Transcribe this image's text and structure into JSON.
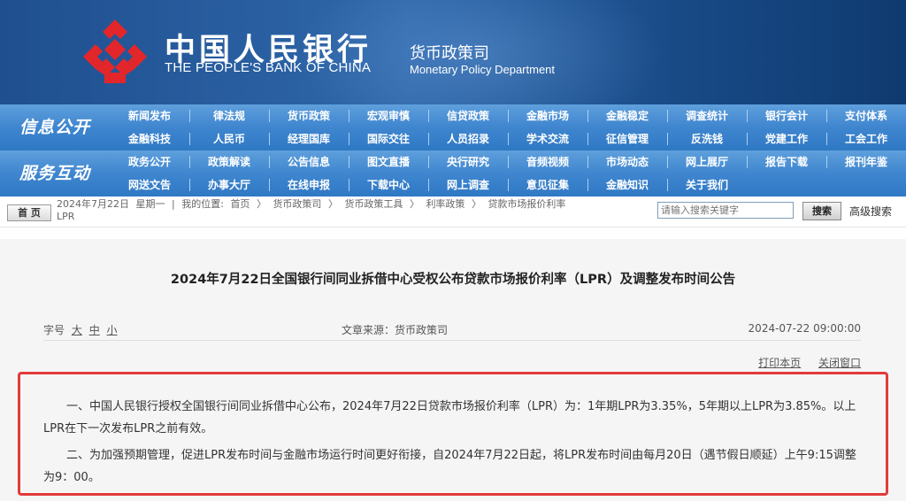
{
  "header": {
    "bank_cn": "中国人民银行",
    "bank_en": "THE PEOPLE'S BANK OF CHINA",
    "dept_cn": "货币政策司",
    "dept_en": "Monetary Policy Department",
    "logo_icon": "pboc-emblem-icon",
    "colors": {
      "banner": "#1f4f8f",
      "logo": "#e3262a",
      "nav": "#3f86cf"
    }
  },
  "nav": {
    "groups": [
      {
        "title": "信息公开",
        "rows": [
          [
            "新闻发布",
            "律法规",
            "货币政策",
            "宏观审慎",
            "信贷政策",
            "金融市场",
            "金融稳定",
            "调查统计",
            "银行会计",
            "支付体系"
          ],
          [
            "金融科技",
            "人民币",
            "经理国库",
            "国际交往",
            "人员招录",
            "学术交流",
            "征信管理",
            "反洗钱",
            "党建工作",
            "工会工作"
          ]
        ]
      },
      {
        "title": "服务互动",
        "rows": [
          [
            "政务公开",
            "政策解读",
            "公告信息",
            "图文直播",
            "央行研究",
            "音频视频",
            "市场动态",
            "网上展厅",
            "报告下载",
            "报刊年鉴"
          ],
          [
            "网送文告",
            "办事大厅",
            "在线申报",
            "下载中心",
            "网上调查",
            "意见征集",
            "金融知识",
            "关于我们"
          ]
        ]
      }
    ]
  },
  "crumbbar": {
    "home_label": "首 页",
    "date": "2024年7月22日",
    "weekday": "星期一",
    "sep": "|",
    "location_label": "我的位置:",
    "path": [
      "首页",
      "货币政策司",
      "货币政策工具",
      "利率政策",
      "贷款市场报价利率"
    ],
    "path_tail": "LPR",
    "arrow": "〉",
    "search_placeholder": "请输入搜索关键字",
    "search_label": "搜索",
    "advanced_label": "高级搜索"
  },
  "article": {
    "title": "2024年7月22日全国银行间同业拆借中心受权公布贷款市场报价利率（LPR）及调整发布时间公告",
    "font_label": "字号",
    "font_sizes": [
      "大",
      "中",
      "小"
    ],
    "source": "文章来源：货币政策司",
    "date": "2024-07-22 09:00:00",
    "print_label": "打印本页",
    "close_label": "关闭窗口",
    "para1": "一、中国人民银行授权全国银行间同业拆借中心公布，2024年7月22日贷款市场报价利率（LPR）为：1年期LPR为3.35%，5年期以上LPR为3.85%。以上LPR在下一次发布LPR之前有效。",
    "para2": "二、为加强预期管理，促进LPR发布时间与金融市场运行时间更好衔接，自2024年7月22日起，将LPR发布时间由每月20日（遇节假日顺延）上午9:15调整为9：00。"
  }
}
